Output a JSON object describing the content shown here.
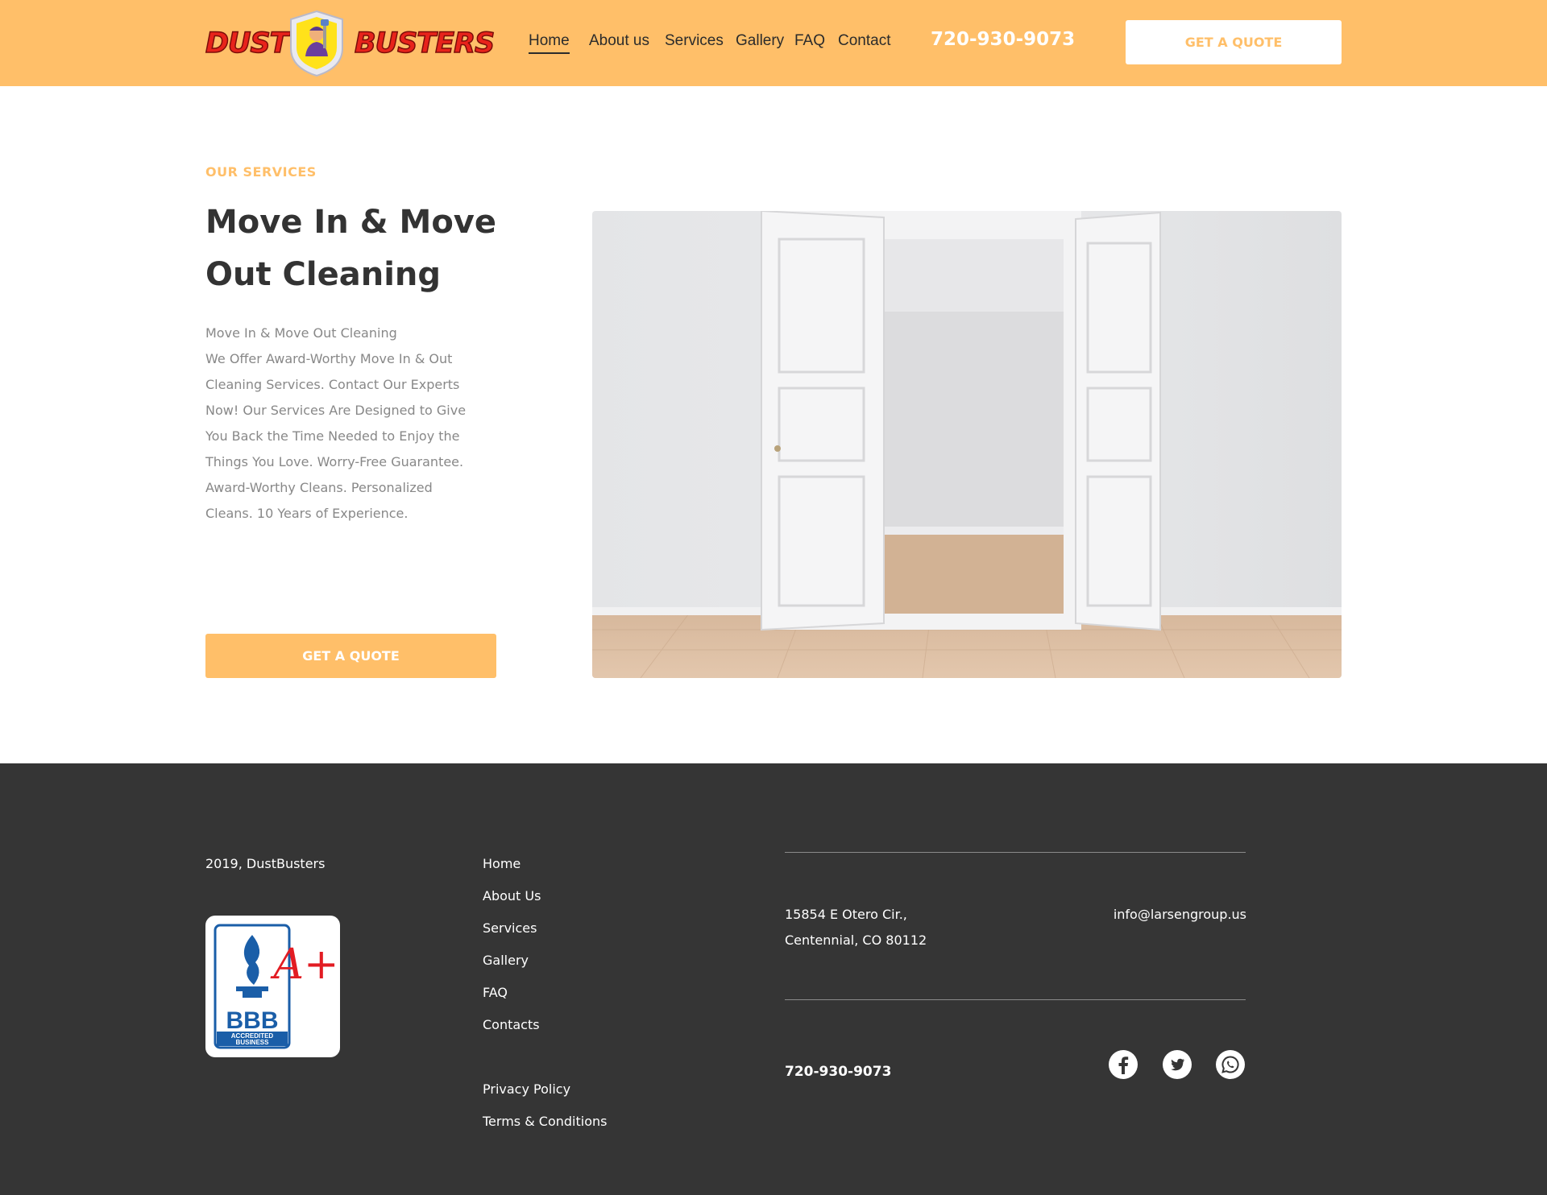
{
  "header": {
    "logo": {
      "word_left": "DUST",
      "word_right": "BUSTERS"
    },
    "nav": [
      {
        "label": "Home",
        "active": true
      },
      {
        "label": "About us",
        "active": false
      },
      {
        "label": "Services",
        "active": false
      },
      {
        "label": "Gallery",
        "active": false
      },
      {
        "label": "FAQ",
        "active": false
      },
      {
        "label": "Contact",
        "active": false
      }
    ],
    "phone": "720-930-9073",
    "quote_button": "GET A QUOTE"
  },
  "main": {
    "eyebrow": "OUR SERVICES",
    "title": "Move In & Move Out Cleaning",
    "description_lines": [
      "Move In & Move Out Cleaning",
      "We Offer Award-Worthy Move In & Out",
      "Cleaning Services. Contact Our Experts",
      "Now! Our Services Are Designed to Give",
      "You Back the Time Needed to Enjoy the",
      "Things You Love. Worry-Free Guarantee.",
      "Award-Worthy Cleans. Personalized",
      "Cleans. 10 Years of Experience."
    ],
    "quote_button": "GET A QUOTE"
  },
  "footer": {
    "copyright": "2019, DustBusters",
    "bbb": {
      "logo_text": "BBB",
      "rating": "A+",
      "accredited_line1": "ACCREDITED",
      "accredited_line2": "BUSINESS"
    },
    "nav": [
      "Home",
      "About Us",
      "Services",
      "Gallery",
      "FAQ",
      "Contacts"
    ],
    "legal": [
      "Privacy Policy",
      "Terms & Conditions"
    ],
    "address_line1": "15854 E Otero Cir.,",
    "address_line2": "Centennial, CO 80112",
    "email": "info@larsengroup.us",
    "phone": "720-930-9073",
    "social": [
      "facebook-icon",
      "twitter-icon",
      "whatsapp-icon"
    ]
  },
  "colors": {
    "accent": "#ffbf69",
    "footer_bg": "#353535",
    "logo_red": "#e8231b"
  }
}
